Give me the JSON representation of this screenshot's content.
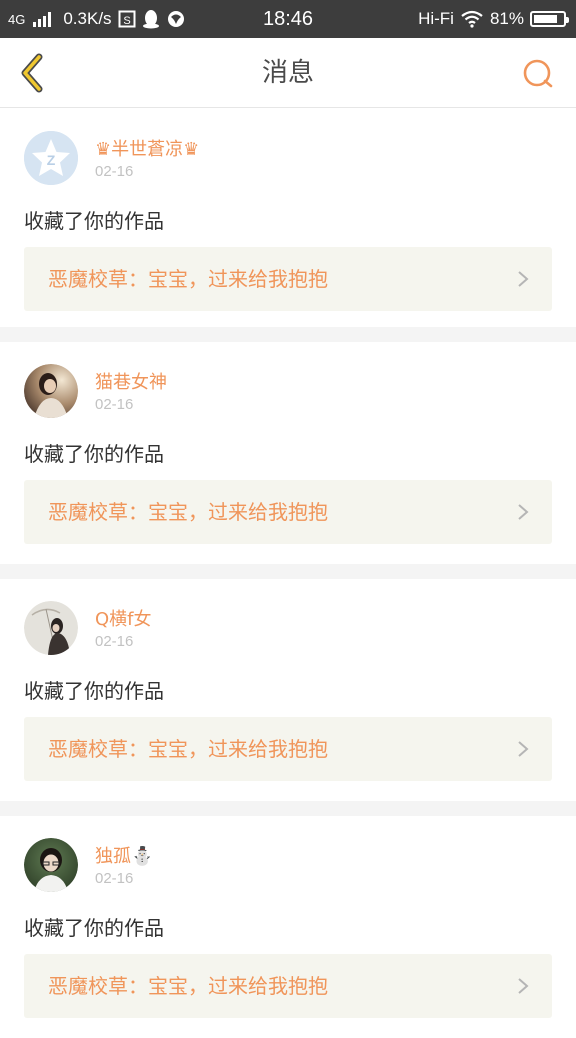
{
  "status_bar": {
    "network_type": "4G",
    "speed": "0.3K/s",
    "time": "18:46",
    "wifi_label": "Hi-Fi",
    "battery": "81%",
    "battery_level": 0.81
  },
  "navbar": {
    "title": "消息",
    "back_icon": "chevron-left-icon",
    "search_icon": "search-icon"
  },
  "colors": {
    "accent": "#f0955a",
    "back_arrow": "#f0c830",
    "card_bg": "#f5f5ee"
  },
  "messages": [
    {
      "username": "♛半世蒼凉♛",
      "date": "02-16",
      "action": "收藏了你的作品",
      "work": "恶魔校草：宝宝，过来给我抱抱",
      "avatar": "default-avatar"
    },
    {
      "username": "猫巷女神",
      "date": "02-16",
      "action": "收藏了你的作品",
      "work": "恶魔校草：宝宝，过来给我抱抱",
      "avatar": "photo-avatar"
    },
    {
      "username": "Q横f女",
      "date": "02-16",
      "action": "收藏了你的作品",
      "work": "恶魔校草：宝宝，过来给我抱抱",
      "avatar": "photo-avatar"
    },
    {
      "username": "独孤⛄",
      "date": "02-16",
      "action": "收藏了你的作品",
      "work": "恶魔校草：宝宝，过来给我抱抱",
      "avatar": "photo-avatar"
    }
  ]
}
